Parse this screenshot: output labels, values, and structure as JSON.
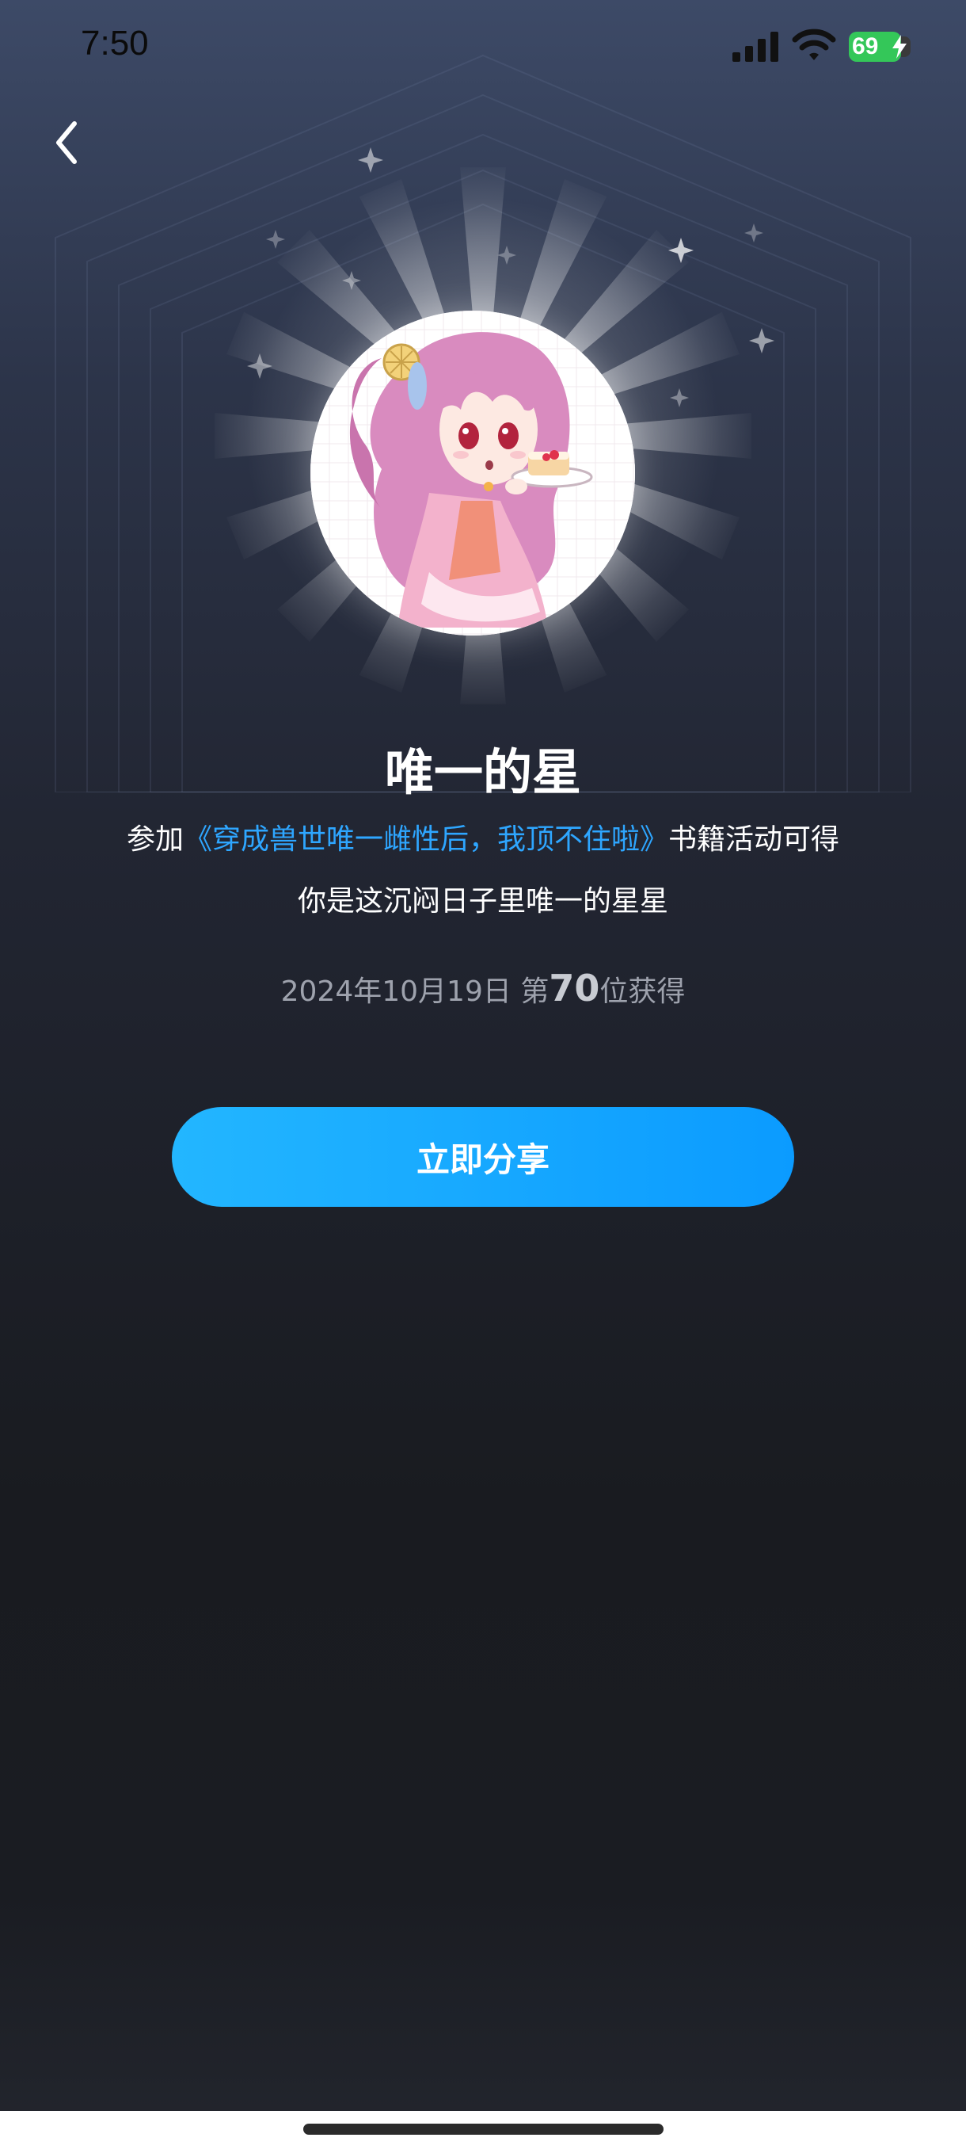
{
  "status_bar": {
    "time": "7:50",
    "battery": "69"
  },
  "badge": {
    "title": "唯一的星",
    "desc_prefix": "参加",
    "book_link": "《穿成兽世唯一雌性后，我顶不住啦》",
    "desc_suffix": "书籍活动可得",
    "quote": "你是这沉闷日子里唯一的星星",
    "date": "2024年10月19日",
    "rank_prefix": "第",
    "rank_number": "70",
    "rank_suffix": "位获得"
  },
  "share_button": {
    "label": "立即分享"
  },
  "colors": {
    "accent": "#0b9bff",
    "link": "#2ea6ff",
    "battery": "#34c759"
  },
  "icons": [
    "back-chevron-icon",
    "signal-icon",
    "wifi-icon",
    "battery-icon",
    "charging-bolt-icon",
    "sparkle-icon"
  ]
}
